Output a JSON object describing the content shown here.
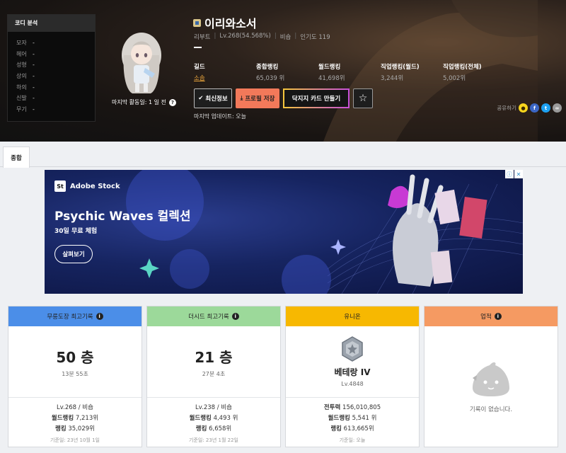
{
  "coordi": {
    "title": "코디 분석",
    "rows": [
      {
        "label": "모자",
        "value": "-"
      },
      {
        "label": "헤어",
        "value": "-"
      },
      {
        "label": "성형",
        "value": "-"
      },
      {
        "label": "상의",
        "value": "-"
      },
      {
        "label": "하의",
        "value": "-"
      },
      {
        "label": "신발",
        "value": "-"
      },
      {
        "label": "무기",
        "value": "-"
      }
    ]
  },
  "character": {
    "name": "이리와소서",
    "world": "리부트",
    "level": "Lv.268(54.568%)",
    "job": "비숍",
    "popularity": "인기도 119",
    "last_active": "마지막 활동일: 1 일 전",
    "last_update": "마지막 업데이트: 오늘"
  },
  "stats": [
    {
      "label": "길드",
      "value": "소솜"
    },
    {
      "label": "종합랭킹",
      "value": "65,039 위"
    },
    {
      "label": "월드랭킹",
      "value": "41,698위"
    },
    {
      "label": "직업랭킹(월드)",
      "value": "3,244위"
    },
    {
      "label": "직업랭킹(전체)",
      "value": "5,002위"
    }
  ],
  "buttons": {
    "refresh": "최신정보",
    "save": "프로필 저장",
    "card": "닥지지 카드 만들기",
    "star": "☆"
  },
  "share": {
    "label": "공유하기"
  },
  "tabs": [
    {
      "label": "종합"
    }
  ],
  "ad": {
    "brand": "Adobe Stock",
    "logo": "St",
    "title": "Psychic Waves 컬렉션",
    "subtitle": "30일 무료 체험",
    "cta": "살펴보기"
  },
  "cards": {
    "mureung": {
      "title": "무릉도장 최고기록",
      "value": "50 층",
      "time": "13분 55초",
      "lv_job": "Lv.268 / 비숍",
      "world_rank_label": "월드랭킹",
      "world_rank": "7,213위",
      "rank_label": "랭킹",
      "rank": "35,029위",
      "date": "기준일: 23년 10월 1일",
      "color": "#4b8ee8"
    },
    "theseed": {
      "title": "더시드 최고기록",
      "value": "21 층",
      "time": "27분 4초",
      "lv_job": "Lv.238 / 비숍",
      "world_rank_label": "월드랭킹",
      "world_rank": "4,493 위",
      "rank_label": "랭킹",
      "rank": "6,658위",
      "date": "기준일: 23년 1월 22일",
      "color": "#9cd99a"
    },
    "union": {
      "title": "유니온",
      "grade": "베테랑 IV",
      "level": "Lv.4848",
      "power_label": "전투력",
      "power": "156,010,805",
      "world_rank_label": "월드랭킹",
      "world_rank": "5,541 위",
      "rank_label": "랭킹",
      "rank": "613,665위",
      "date": "기준일: 오늘",
      "color": "#f7b801"
    },
    "achievement": {
      "title": "업적",
      "empty": "기록이 없습니다.",
      "color": "#f59a62"
    }
  }
}
